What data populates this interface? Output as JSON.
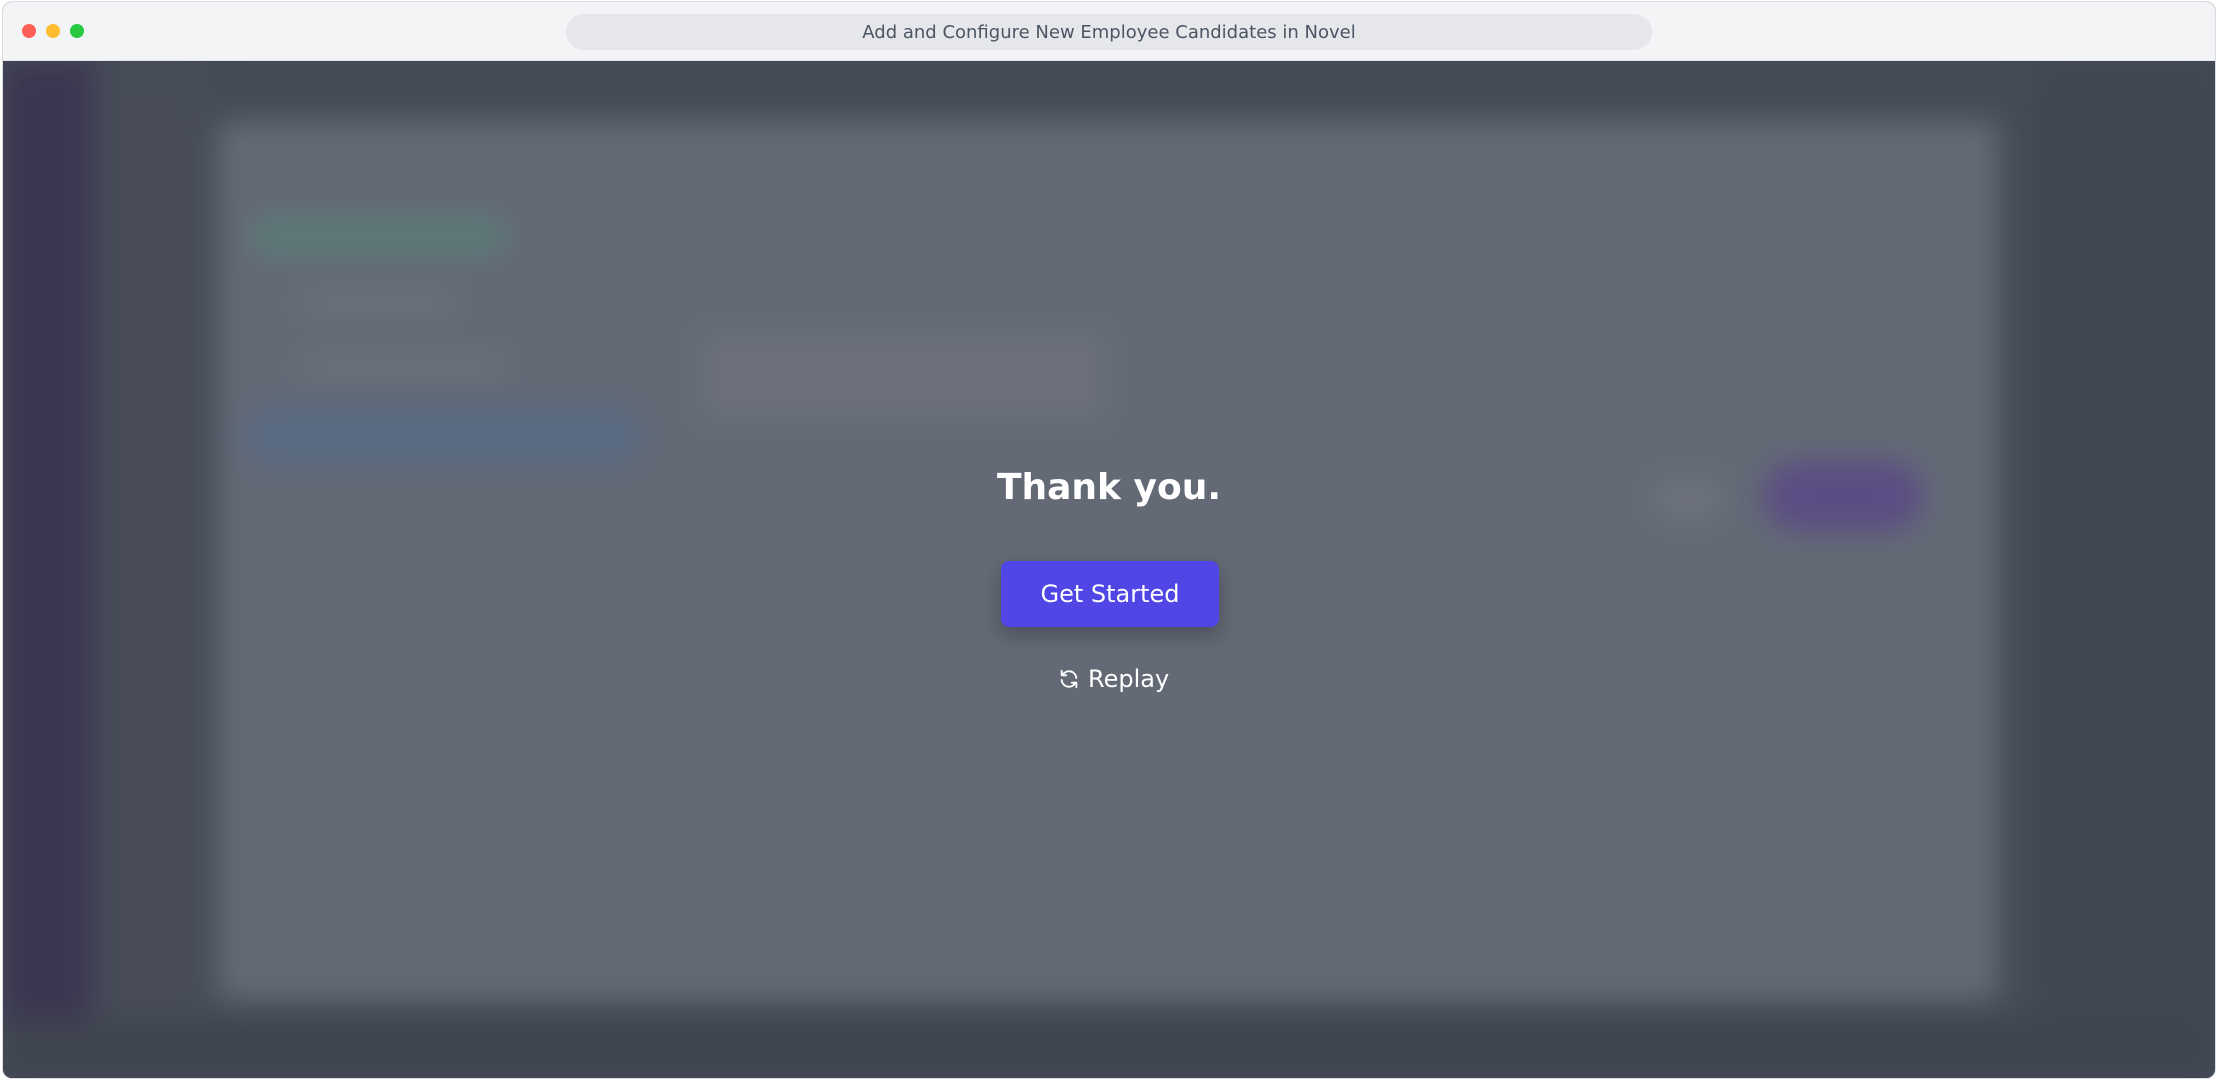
{
  "window": {
    "title": "Add and Configure New Employee Candidates in Novel"
  },
  "overlay": {
    "message": "Thank you.",
    "primary_button": "Get Started",
    "replay_label": "Replay",
    "replay_icon": "refresh-icon",
    "primary_color": "#4f46e5"
  }
}
